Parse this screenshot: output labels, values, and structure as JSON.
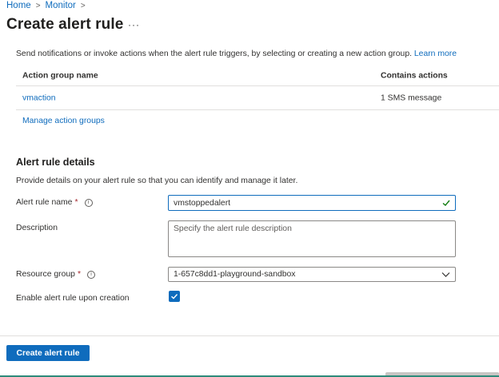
{
  "breadcrumb": {
    "home": "Home",
    "monitor": "Monitor",
    "separator": ">"
  },
  "page": {
    "title": "Create alert rule",
    "more": "···"
  },
  "actions": {
    "intro_text": "Send notifications or invoke actions when the alert rule triggers, by selecting or creating a new action group.",
    "learn_more": "Learn more",
    "columns": {
      "name": "Action group name",
      "contains": "Contains actions"
    },
    "rows": [
      {
        "name": "vmaction",
        "contains": "1 SMS message"
      }
    ],
    "manage_link": "Manage action groups"
  },
  "details": {
    "title": "Alert rule details",
    "description": "Provide details on your alert rule so that you can identify and manage it later.",
    "fields": {
      "rule_name": {
        "label": "Alert rule name",
        "required_mark": "*",
        "value": "vmstoppedalert"
      },
      "description": {
        "label": "Description",
        "placeholder": "Specify the alert rule description"
      },
      "resource_group": {
        "label": "Resource group",
        "required_mark": "*",
        "value": "1-657c8dd1-playground-sandbox"
      },
      "enable": {
        "label": "Enable alert rule upon creation",
        "checked": true
      }
    },
    "info_glyph": "i"
  },
  "footer": {
    "create_button": "Create alert rule"
  },
  "colors": {
    "accent": "#0f6cbd",
    "required": "#a4262c",
    "text": "#323130"
  }
}
